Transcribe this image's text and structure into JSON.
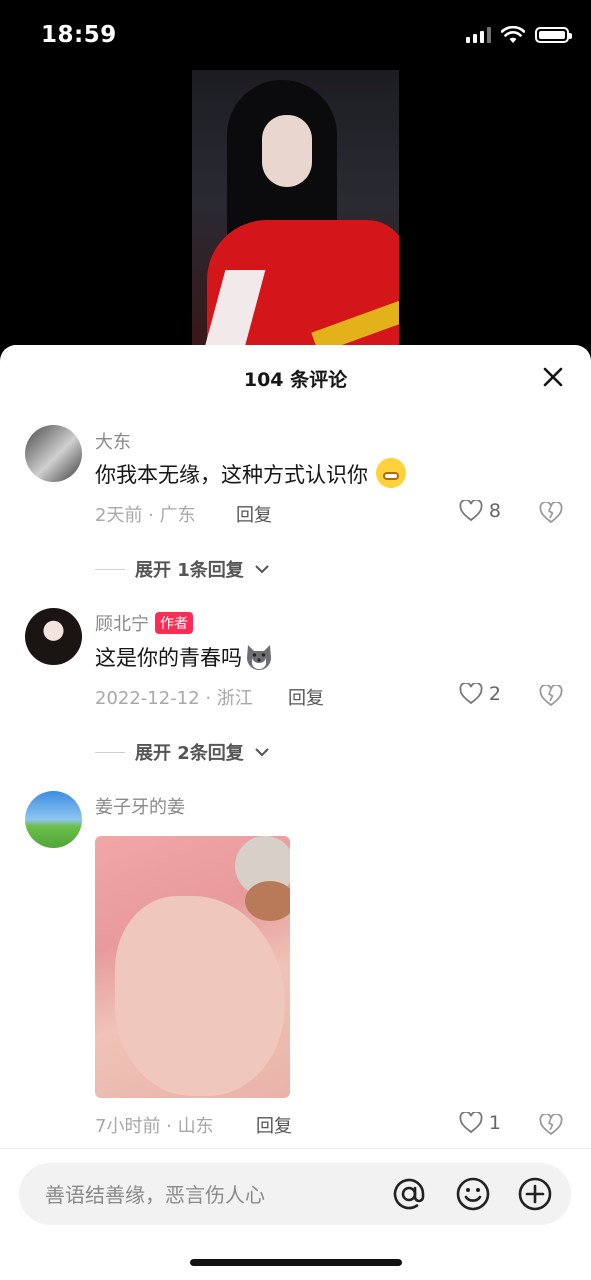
{
  "status_bar": {
    "time": "18:59"
  },
  "sheet": {
    "title": "104 条评论"
  },
  "comments": [
    {
      "name": "大东",
      "text": "你我本无缘，这种方式认识你",
      "emoji": "grinning-emoji",
      "meta": "2天前 · 广东",
      "reply_label": "回复",
      "likes": "8",
      "expand_label": "展开 1条回复"
    },
    {
      "name": "顾北宁",
      "tag": "作者",
      "text": "这是你的青春吗",
      "emoji": "husky-emoji",
      "meta": "2022-12-12 · 浙江",
      "reply_label": "回复",
      "likes": "2",
      "expand_label": "展开 2条回复"
    },
    {
      "name": "姜子牙的姜",
      "meta": "7小时前 · 山东",
      "reply_label": "回复",
      "likes": "1"
    }
  ],
  "input": {
    "placeholder": "善语结善缘，恶言伤人心"
  },
  "icons": {
    "close": "close-icon",
    "like": "heart-outline-icon",
    "dislike": "broken-heart-icon",
    "mention": "at-icon",
    "emoji": "smiley-icon",
    "add": "plus-circle-icon"
  },
  "colors": {
    "author_tag": "#fe2c55",
    "sheet_bg": "#ffffff",
    "page_bg": "#000000"
  }
}
